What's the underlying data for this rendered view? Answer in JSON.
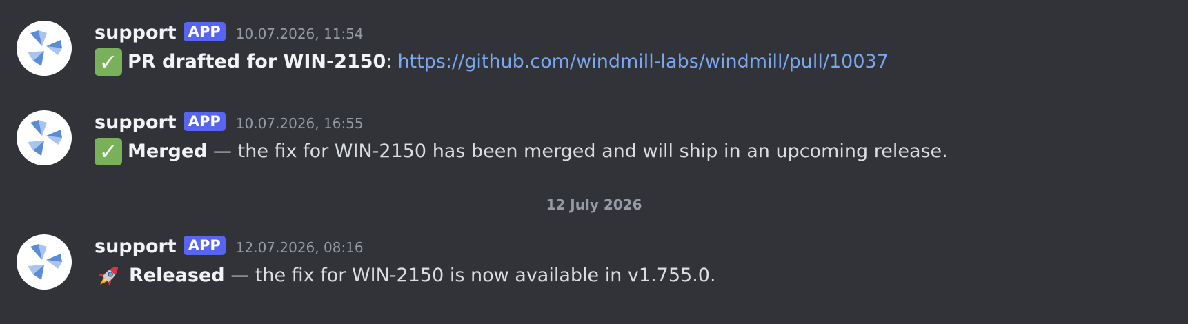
{
  "messages": [
    {
      "username": "support",
      "badge": "APP",
      "timestamp": "10.07.2026, 11:54",
      "emoji": "white-check-mark",
      "bold": "PR drafted for WIN-2150",
      "text": ":",
      "link": "https://github.com/windmill-labs/windmill/pull/10037"
    },
    {
      "username": "support",
      "badge": "APP",
      "timestamp": "10.07.2026, 16:55",
      "emoji": "white-check-mark",
      "bold": "Merged",
      "text": " — the fix for WIN-2150 has been merged and will ship in an upcoming release."
    },
    {
      "username": "support",
      "badge": "APP",
      "timestamp": "12.07.2026, 08:16",
      "emoji": "rocket",
      "bold": "Released",
      "text": " — the fix for WIN-2150 is now available in v1.755.0."
    }
  ],
  "divider": {
    "label": "12 July 2026"
  },
  "colors": {
    "background": "#313338",
    "badge": "#5865f2",
    "link": "#7aa7f0",
    "check_emoji": "#78b159"
  }
}
